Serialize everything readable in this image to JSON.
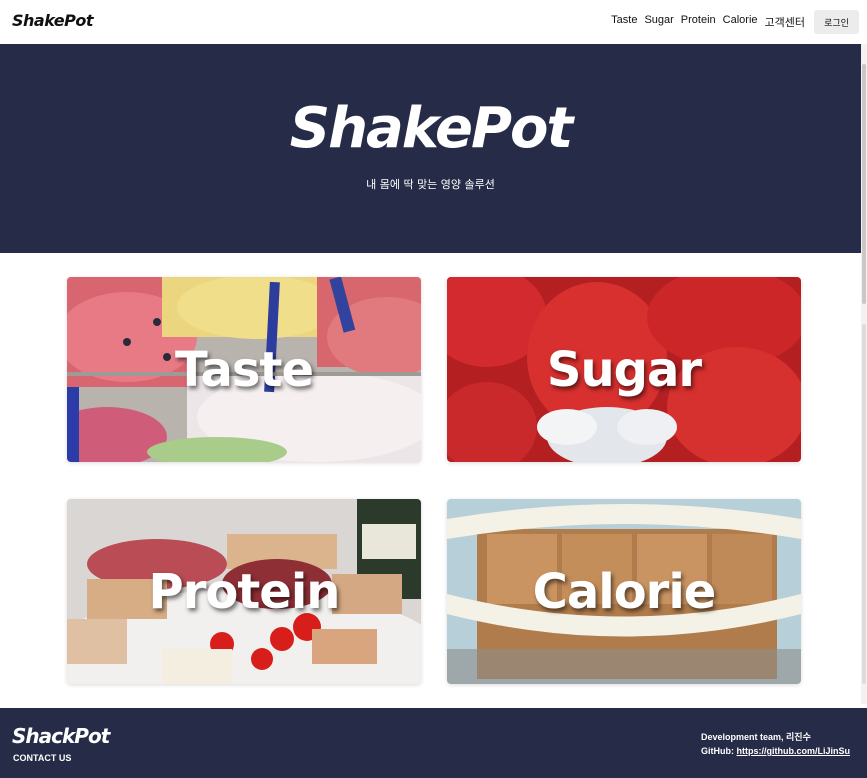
{
  "header": {
    "logo": "ShakePot",
    "nav": [
      "Taste",
      "Sugar",
      "Protein",
      "Calorie",
      "고객센터"
    ],
    "login_label": "로그인"
  },
  "hero": {
    "logo": "ShakePot",
    "subtitle": "내 몸에 딱 맞는 영양 솔루션"
  },
  "cards": [
    {
      "label": "Taste"
    },
    {
      "label": "Sugar"
    },
    {
      "label": "Protein"
    },
    {
      "label": "Calorie"
    }
  ],
  "footer": {
    "logo": "ShackPot",
    "contact": "CONTACT US",
    "team_label": "Development team, 리진수",
    "github_prefix": "GitHub: ",
    "github_link": "https://github.com/LiJinSu"
  },
  "colors": {
    "navy": "#262c47",
    "white": "#ffffff"
  }
}
